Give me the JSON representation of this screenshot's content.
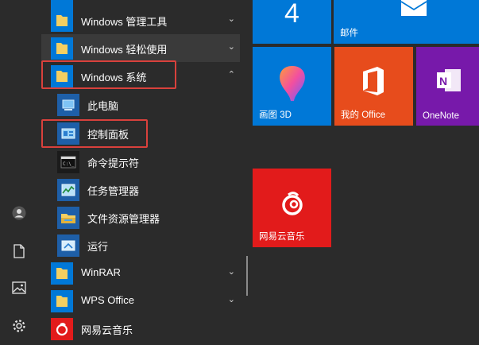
{
  "app_list": {
    "groups": [
      {
        "label": "Windows 管理工具",
        "chevron": "⌄"
      },
      {
        "label": "Windows 轻松使用",
        "chevron": "⌄"
      },
      {
        "label": "Windows 系统",
        "chevron": "⌃"
      }
    ],
    "system_items": [
      {
        "label": "此电脑",
        "icon": "computer-icon"
      },
      {
        "label": "控制面板",
        "icon": "control-panel-icon"
      },
      {
        "label": "命令提示符",
        "icon": "command-prompt-icon"
      },
      {
        "label": "任务管理器",
        "icon": "task-manager-icon"
      },
      {
        "label": "文件资源管理器",
        "icon": "file-explorer-icon"
      },
      {
        "label": "运行",
        "icon": "run-icon"
      }
    ],
    "more_groups": [
      {
        "label": "WinRAR",
        "chevron": "⌄"
      },
      {
        "label": "WPS Office",
        "chevron": "⌄"
      }
    ],
    "netease_app": {
      "label": "网易云音乐"
    }
  },
  "rail": {
    "icons": [
      "user-icon",
      "document-icon",
      "pictures-icon",
      "settings-icon"
    ]
  },
  "tiles": {
    "calendar_number": "4",
    "mail_label": "邮件",
    "paint3d_label": "画图 3D",
    "office_label": "我的 Office",
    "onenote_label": "OneNote",
    "netease_label": "网易云音乐"
  },
  "colors": {
    "accent": "#0078d7",
    "highlight_box": "#d9413c",
    "office_orange": "#e74c1c",
    "onenote_purple": "#7719aa",
    "netease_red": "#e21b1b",
    "folder_yellow": "#f4cf61"
  }
}
